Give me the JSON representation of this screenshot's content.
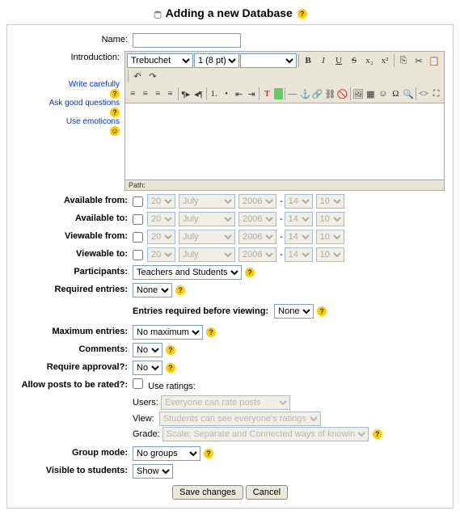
{
  "title": "Adding a new Database",
  "labels": {
    "name": "Name:",
    "introduction": "Introduction:",
    "available_from": "Available from:",
    "available_to": "Available to:",
    "viewable_from": "Viewable from:",
    "viewable_to": "Viewable to:",
    "participants": "Participants:",
    "required_entries": "Required entries:",
    "entries_required_viewing": "Entries required before viewing:",
    "maximum_entries": "Maximum entries:",
    "comments": "Comments:",
    "require_approval": "Require approval?:",
    "allow_rated": "Allow posts to be rated?:",
    "group_mode": "Group mode:",
    "visible_students": "Visible to students:"
  },
  "tips": {
    "write": "Write carefully",
    "ask": "Ask good questions",
    "emoticons": "Use emoticons"
  },
  "editor": {
    "font": "Trebuchet",
    "size": "1 (8 pt)",
    "style_placeholder": "",
    "path_label": "Path:"
  },
  "date": {
    "day": "20",
    "month": "July",
    "year": "2006",
    "hour": "14",
    "min": "10"
  },
  "values": {
    "participants": "Teachers and Students",
    "required_entries": "None",
    "entries_required_viewing": "None",
    "maximum_entries": "No maximum",
    "comments": "No",
    "require_approval": "No",
    "group_mode": "No groups",
    "visible": "Show"
  },
  "ratings": {
    "use_label": "Use ratings:",
    "users_label": "Users:",
    "users_val": "Everyone can rate posts",
    "view_label": "View:",
    "view_val": "Students can see everyone's ratings",
    "grade_label": "Grade:",
    "grade_val": "Scale: Separate and Connected ways of knowing"
  },
  "buttons": {
    "save": "Save changes",
    "cancel": "Cancel"
  }
}
